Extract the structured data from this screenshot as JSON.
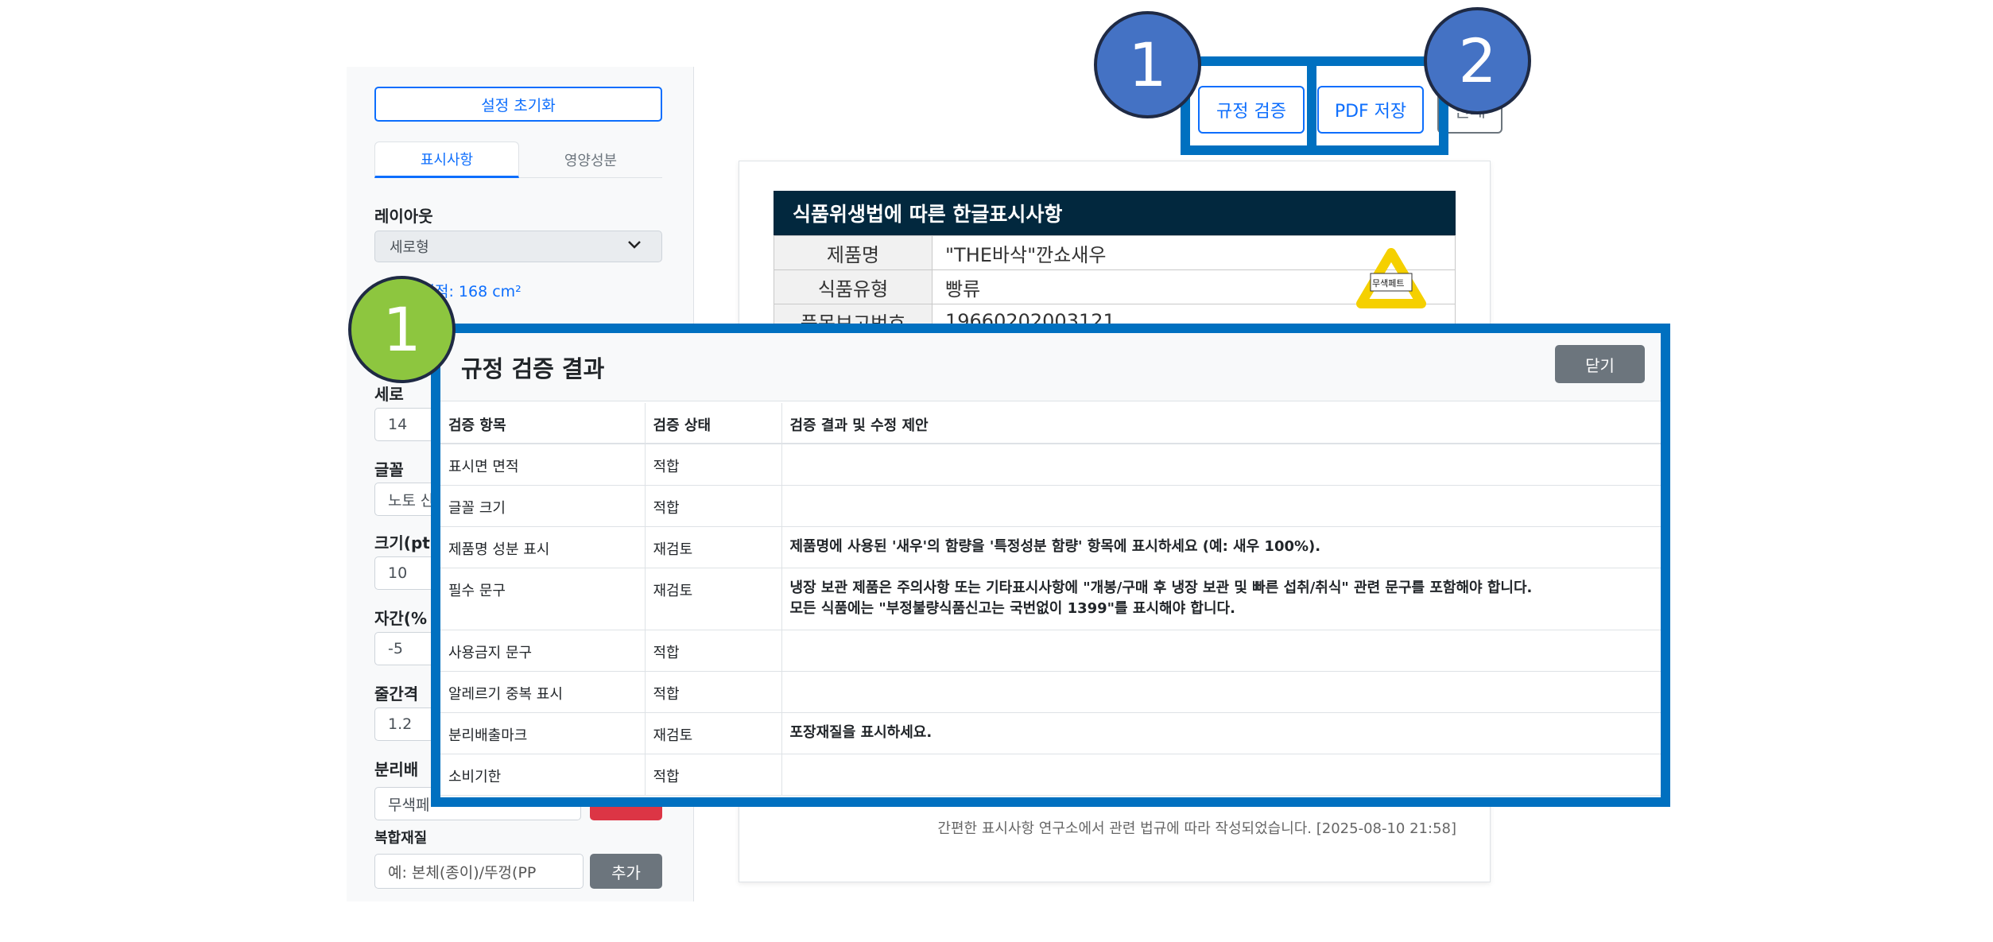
{
  "sidebar": {
    "reset_label": "설정 초기화",
    "tabs": [
      {
        "label": "표시사항",
        "active": true
      },
      {
        "label": "영양성분",
        "active": false
      }
    ],
    "layout_label": "레이아웃",
    "layout_value": "세로형",
    "area_info": "면 면적: 168 cm²",
    "height_label": "세로",
    "height_value": "14",
    "font_label": "글꼴",
    "font_value": "노토 산",
    "size_label": "크기(pt",
    "size_value": "10",
    "spacing_label": "자간(%",
    "spacing_value": "-5",
    "line_label": "줄간격",
    "line_value": "1.2",
    "recycle_label": "분리배",
    "recycle_value": "무색페",
    "composite_label": "복합재질",
    "composite_placeholder": "예: 본체(종이)/뚜껑(PP",
    "add_label": "추가"
  },
  "toolbar": {
    "verify_label": "규정 검증",
    "pdf_label": "PDF 저장",
    "print_label": "인쇄"
  },
  "callouts": {
    "blue_1": "1",
    "blue_2": "2",
    "green_1": "1"
  },
  "label": {
    "header": "식품위생법에 따른 한글표시사항",
    "rows": [
      {
        "key": "제품명",
        "value": "\"THE바삭\"깐쇼새우"
      },
      {
        "key": "식품유형",
        "value": "빵류"
      },
      {
        "key": "품목보고번호",
        "value": "19660202003121"
      }
    ],
    "recycle_mark_text": "무색페트",
    "footer": "간편한 표시사항 연구소에서 관련 법규에 따라 작성되었습니다. [2025-08-10 21:58]"
  },
  "modal": {
    "title": "규정 검증 결과",
    "close_label": "닫기",
    "columns": [
      "검증 항목",
      "검증 상태",
      "검증 결과 및 수정 제안"
    ],
    "rows": [
      {
        "item": "표시면 면적",
        "status": "적합",
        "result": ""
      },
      {
        "item": "글꼴 크기",
        "status": "적합",
        "result": ""
      },
      {
        "item": "제품명 성분 표시",
        "status": "재검토",
        "result": "제품명에 사용된 '새우'의 함량을 '특정성분 함량' 항목에 표시하세요 (예: 새우 100%)."
      },
      {
        "item": "필수 문구",
        "status": "재검토",
        "result": "냉장 보관 제품은 주의사항 또는 기타표시사항에 \"개봉/구매 후 냉장 보관 및 빠른 섭취/취식\" 관련 문구를 포함해야 합니다.",
        "result2": "모든 식품에는 \"부정불량식품신고는 국번없이 1399\"를 표시해야 합니다."
      },
      {
        "item": "사용금지 문구",
        "status": "적합",
        "result": ""
      },
      {
        "item": "알레르기 중복 표시",
        "status": "적합",
        "result": ""
      },
      {
        "item": "분리배출마크",
        "status": "재검토",
        "result": "포장재질을 표시하세요."
      },
      {
        "item": "소비기한",
        "status": "적합",
        "result": ""
      }
    ]
  },
  "colors": {
    "highlight_border": "#0070c0",
    "callout_blue": "#4472c4",
    "callout_green": "#8dc63f",
    "status_ok": "#198754",
    "status_review": "#dc3545"
  }
}
